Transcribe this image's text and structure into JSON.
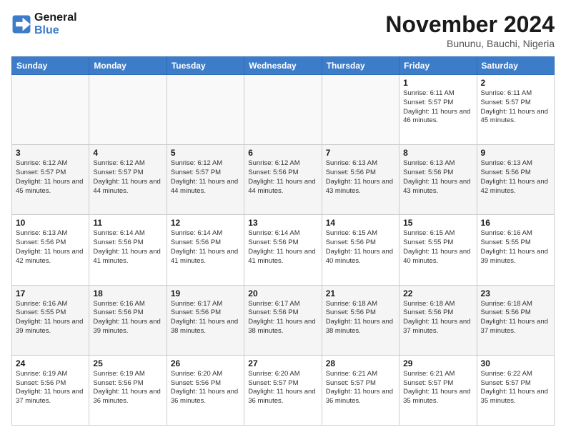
{
  "logo": {
    "general": "General",
    "blue": "Blue"
  },
  "title": "November 2024",
  "location": "Bununu, Bauchi, Nigeria",
  "weekdays": [
    "Sunday",
    "Monday",
    "Tuesday",
    "Wednesday",
    "Thursday",
    "Friday",
    "Saturday"
  ],
  "weeks": [
    [
      {
        "day": "",
        "info": ""
      },
      {
        "day": "",
        "info": ""
      },
      {
        "day": "",
        "info": ""
      },
      {
        "day": "",
        "info": ""
      },
      {
        "day": "",
        "info": ""
      },
      {
        "day": "1",
        "info": "Sunrise: 6:11 AM\nSunset: 5:57 PM\nDaylight: 11 hours\nand 46 minutes."
      },
      {
        "day": "2",
        "info": "Sunrise: 6:11 AM\nSunset: 5:57 PM\nDaylight: 11 hours\nand 45 minutes."
      }
    ],
    [
      {
        "day": "3",
        "info": "Sunrise: 6:12 AM\nSunset: 5:57 PM\nDaylight: 11 hours\nand 45 minutes."
      },
      {
        "day": "4",
        "info": "Sunrise: 6:12 AM\nSunset: 5:57 PM\nDaylight: 11 hours\nand 44 minutes."
      },
      {
        "day": "5",
        "info": "Sunrise: 6:12 AM\nSunset: 5:57 PM\nDaylight: 11 hours\nand 44 minutes."
      },
      {
        "day": "6",
        "info": "Sunrise: 6:12 AM\nSunset: 5:56 PM\nDaylight: 11 hours\nand 44 minutes."
      },
      {
        "day": "7",
        "info": "Sunrise: 6:13 AM\nSunset: 5:56 PM\nDaylight: 11 hours\nand 43 minutes."
      },
      {
        "day": "8",
        "info": "Sunrise: 6:13 AM\nSunset: 5:56 PM\nDaylight: 11 hours\nand 43 minutes."
      },
      {
        "day": "9",
        "info": "Sunrise: 6:13 AM\nSunset: 5:56 PM\nDaylight: 11 hours\nand 42 minutes."
      }
    ],
    [
      {
        "day": "10",
        "info": "Sunrise: 6:13 AM\nSunset: 5:56 PM\nDaylight: 11 hours\nand 42 minutes."
      },
      {
        "day": "11",
        "info": "Sunrise: 6:14 AM\nSunset: 5:56 PM\nDaylight: 11 hours\nand 41 minutes."
      },
      {
        "day": "12",
        "info": "Sunrise: 6:14 AM\nSunset: 5:56 PM\nDaylight: 11 hours\nand 41 minutes."
      },
      {
        "day": "13",
        "info": "Sunrise: 6:14 AM\nSunset: 5:56 PM\nDaylight: 11 hours\nand 41 minutes."
      },
      {
        "day": "14",
        "info": "Sunrise: 6:15 AM\nSunset: 5:56 PM\nDaylight: 11 hours\nand 40 minutes."
      },
      {
        "day": "15",
        "info": "Sunrise: 6:15 AM\nSunset: 5:55 PM\nDaylight: 11 hours\nand 40 minutes."
      },
      {
        "day": "16",
        "info": "Sunrise: 6:16 AM\nSunset: 5:55 PM\nDaylight: 11 hours\nand 39 minutes."
      }
    ],
    [
      {
        "day": "17",
        "info": "Sunrise: 6:16 AM\nSunset: 5:55 PM\nDaylight: 11 hours\nand 39 minutes."
      },
      {
        "day": "18",
        "info": "Sunrise: 6:16 AM\nSunset: 5:56 PM\nDaylight: 11 hours\nand 39 minutes."
      },
      {
        "day": "19",
        "info": "Sunrise: 6:17 AM\nSunset: 5:56 PM\nDaylight: 11 hours\nand 38 minutes."
      },
      {
        "day": "20",
        "info": "Sunrise: 6:17 AM\nSunset: 5:56 PM\nDaylight: 11 hours\nand 38 minutes."
      },
      {
        "day": "21",
        "info": "Sunrise: 6:18 AM\nSunset: 5:56 PM\nDaylight: 11 hours\nand 38 minutes."
      },
      {
        "day": "22",
        "info": "Sunrise: 6:18 AM\nSunset: 5:56 PM\nDaylight: 11 hours\nand 37 minutes."
      },
      {
        "day": "23",
        "info": "Sunrise: 6:18 AM\nSunset: 5:56 PM\nDaylight: 11 hours\nand 37 minutes."
      }
    ],
    [
      {
        "day": "24",
        "info": "Sunrise: 6:19 AM\nSunset: 5:56 PM\nDaylight: 11 hours\nand 37 minutes."
      },
      {
        "day": "25",
        "info": "Sunrise: 6:19 AM\nSunset: 5:56 PM\nDaylight: 11 hours\nand 36 minutes."
      },
      {
        "day": "26",
        "info": "Sunrise: 6:20 AM\nSunset: 5:56 PM\nDaylight: 11 hours\nand 36 minutes."
      },
      {
        "day": "27",
        "info": "Sunrise: 6:20 AM\nSunset: 5:57 PM\nDaylight: 11 hours\nand 36 minutes."
      },
      {
        "day": "28",
        "info": "Sunrise: 6:21 AM\nSunset: 5:57 PM\nDaylight: 11 hours\nand 36 minutes."
      },
      {
        "day": "29",
        "info": "Sunrise: 6:21 AM\nSunset: 5:57 PM\nDaylight: 11 hours\nand 35 minutes."
      },
      {
        "day": "30",
        "info": "Sunrise: 6:22 AM\nSunset: 5:57 PM\nDaylight: 11 hours\nand 35 minutes."
      }
    ]
  ]
}
